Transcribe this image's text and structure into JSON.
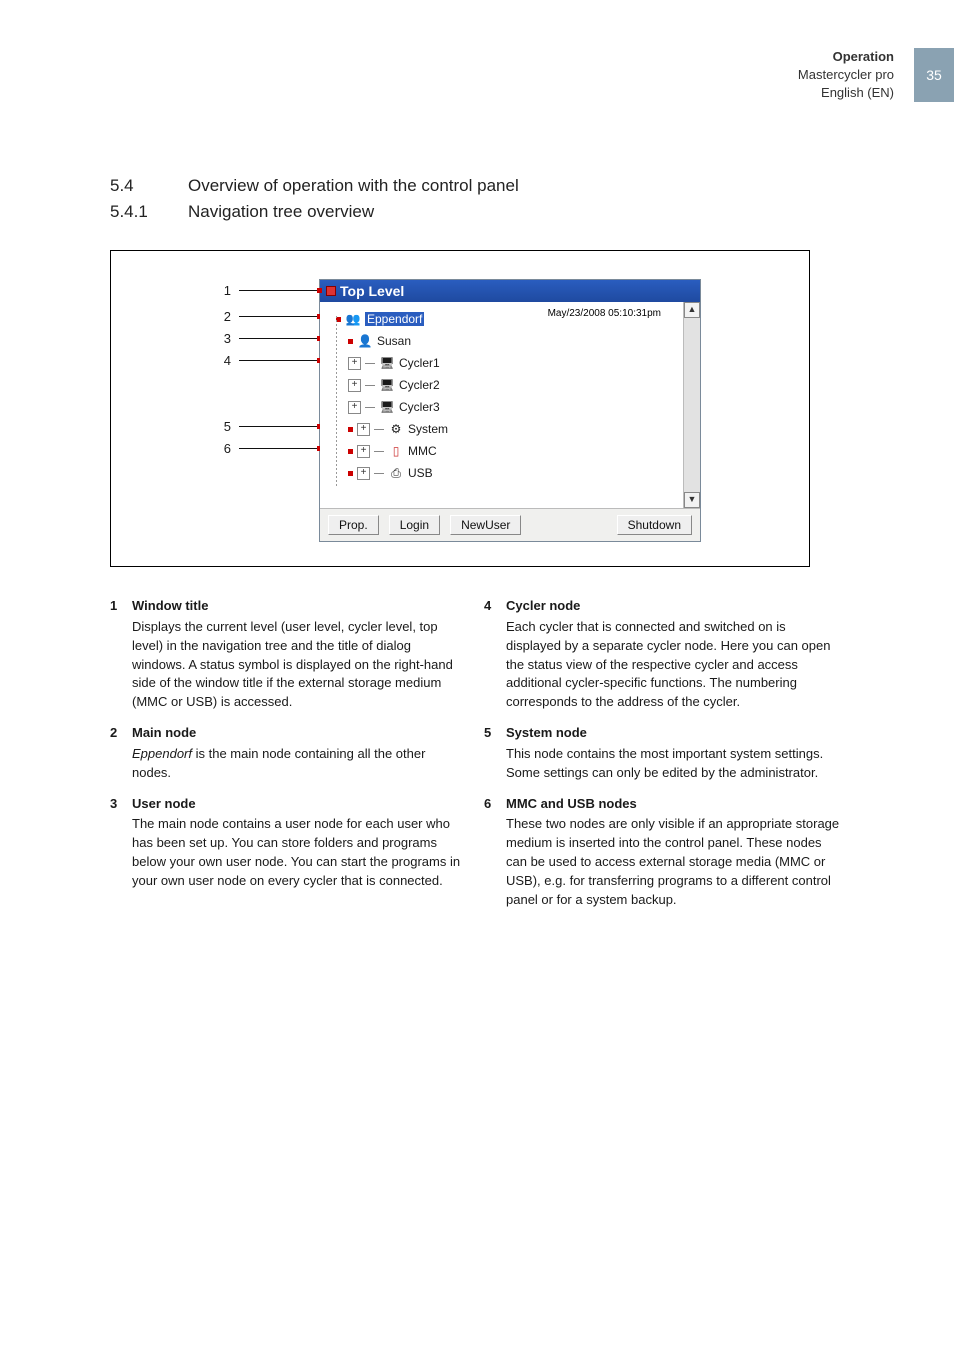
{
  "page": {
    "number": "35",
    "header_bold": "Operation",
    "header_line2": "Mastercycler pro",
    "header_line3": "English (EN)"
  },
  "sections": {
    "s54_num": "5.4",
    "s54_title": "Overview of operation with the control panel",
    "s541_num": "5.4.1",
    "s541_title": "Navigation tree overview"
  },
  "callouts": [
    "1",
    "2",
    "3",
    "4",
    "5",
    "6"
  ],
  "window": {
    "title": "Top Level",
    "timestamp": "May/23/2008 05:10:31pm",
    "nodes": {
      "eppendorf": "Eppendorf",
      "susan": "Susan",
      "cycler1": "Cycler1",
      "cycler2": "Cycler2",
      "cycler3": "Cycler3",
      "system": "System",
      "mmc": "MMC",
      "usb": "USB"
    },
    "buttons": {
      "prop": "Prop.",
      "login": "Login",
      "newuser": "NewUser",
      "shutdown": "Shutdown"
    },
    "scroll_up": "▲",
    "scroll_down": "▼"
  },
  "legend": {
    "i1": {
      "n": "1",
      "title": "Window title",
      "body": "Displays the current level (user level, cycler level, top level) in the navigation tree and the title of dialog windows. A status symbol is displayed on the right-hand side of the window title if the external storage medium (MMC or USB) is accessed."
    },
    "i2": {
      "n": "2",
      "title": "Main node",
      "body_prefix_italic": "Eppendorf",
      "body_rest": " is the main node containing all the other nodes."
    },
    "i3": {
      "n": "3",
      "title": "User node",
      "body": "The main node contains a user node for each user who has been set up. You can store folders and programs below your own user node. You can start the programs in your own user node on every cycler that is connected."
    },
    "i4": {
      "n": "4",
      "title": "Cycler node",
      "body": "Each cycler that is connected and switched on is displayed by a separate cycler node. Here you can open the status view of the respective cycler and access additional cycler-specific functions. The numbering corresponds to the address of the cycler."
    },
    "i5": {
      "n": "5",
      "title": "System node",
      "body": "This node contains the most important system settings. Some settings can only be edited by the administrator."
    },
    "i6": {
      "n": "6",
      "title": "MMC and USB nodes",
      "body": "These two nodes are only visible if an appropriate storage medium is inserted into the control panel. These nodes can be used to access external storage media (MMC or USB), e.g. for transferring programs to a different control panel or for a system backup."
    }
  }
}
